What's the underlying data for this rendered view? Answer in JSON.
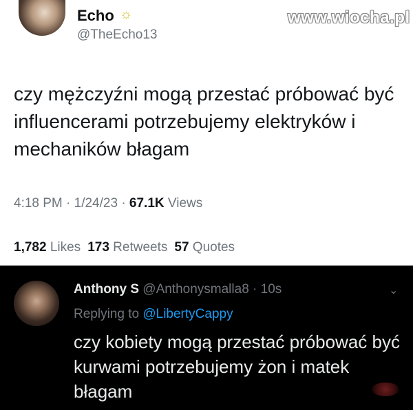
{
  "tweet": {
    "author_name": "Echo",
    "badge_icon": "sun-icon",
    "handle": "@TheEcho13",
    "text": "czy mężczyźni mogą przestać próbować być influencerami potrzebujemy elektryków i mechaników błagam",
    "time": "4:18 PM · 1/24/23 · ",
    "views_count": "67.1K",
    "views_label": " Views",
    "likes_count": "1,782",
    "likes_label": " Likes",
    "retweets_count": "173",
    "retweets_label": " Retweets",
    "quotes_count": "57",
    "quotes_label": " Quotes"
  },
  "watermark": "www.wiocha.pl",
  "reply": {
    "author_name": "Anthony S",
    "handle_time": " @Anthonysmalla8 · 10s",
    "replying_prefix": "Replying to ",
    "replying_mention": "@LibertyCappy",
    "text": "czy kobiety mogą przestać próbować być kurwami potrzebujemy żon i matek błagam",
    "menu_icon": "chevron-down-icon"
  },
  "colors": {
    "reply_background": "#000000",
    "mention": "#1d9bf0"
  }
}
